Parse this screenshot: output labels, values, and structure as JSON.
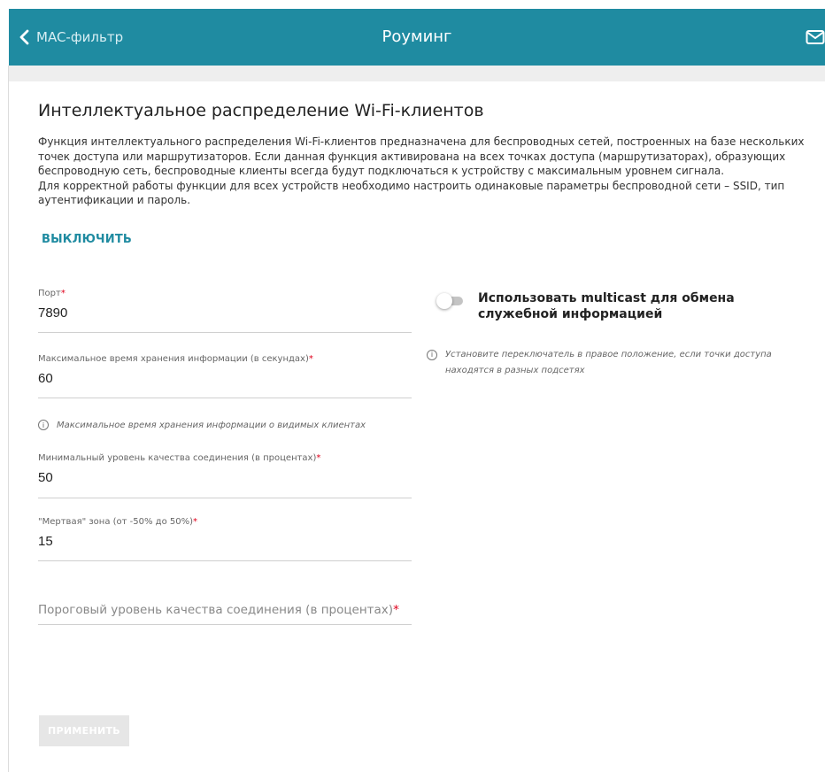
{
  "header": {
    "back_label": "MAC-фильтр",
    "title": "Роуминг",
    "bg_color": "#1f8ba1"
  },
  "section": {
    "title": "Интеллектуальное распределение Wi-Fi-клиентов",
    "description_1": "Функция интеллектуального распределения Wi-Fi-клиентов предназначена для беспроводных сетей, построенных на базе нескольких точек доступа или маршрутизаторов. Если данная функция активирована на всех точках доступа (маршрутизаторах), образующих беспроводную сеть, беспроводные клиенты всегда будут подключаться к устройству с максимальным уровнем сигнала.",
    "description_2": "Для корректной работы функции для всех устройств необходимо настроить одинаковые параметры беспроводной сети – SSID, тип аутентификации и пароль.",
    "disable_label": "ВЫКЛЮЧИТЬ"
  },
  "fields": {
    "port": {
      "label": "Порт",
      "required_mark": "*",
      "value": "7890"
    },
    "max_time": {
      "label": "Максимальное время хранения информации (в секундах)",
      "required_mark": "*",
      "value": "60"
    },
    "max_time_hint": "Максимальное время хранения информации о видимых клиентах",
    "min_quality": {
      "label": "Минимальный уровень качества соединения (в процентах)",
      "required_mark": "*",
      "value": "50"
    },
    "dead_zone": {
      "label": "\"Мертвая\" зона (от -50% до 50%)",
      "required_mark": "*",
      "value": "15"
    },
    "threshold": {
      "placeholder": "Пороговый уровень качества соединения (в процентах)",
      "required_mark": "*"
    }
  },
  "multicast": {
    "label": "Использовать multicast для обмена служебной информацией",
    "enabled": false,
    "hint": "Установите переключатель в правое положение, если точки доступа находятся в разных подсетях"
  },
  "info_icon_glyph": "i",
  "apply_label": "ПРИМЕНИТЬ",
  "icons": {
    "back": "chevron-left-icon",
    "mail": "mail-icon",
    "info": "info-icon"
  }
}
